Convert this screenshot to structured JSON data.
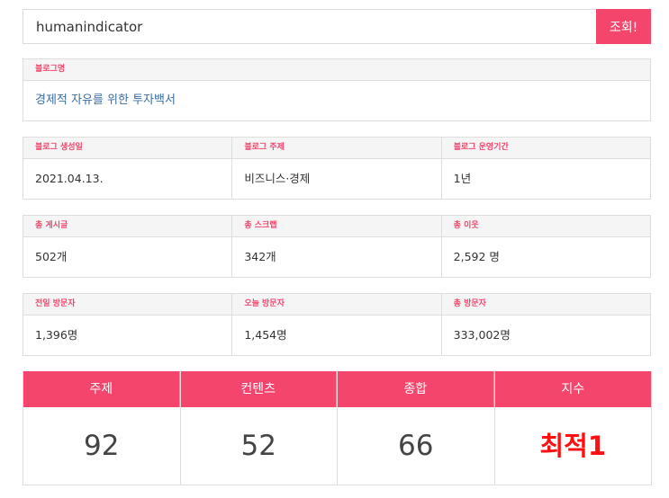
{
  "search": {
    "value": "humanindicator",
    "button_label": "조회!"
  },
  "blog": {
    "name_label": "블로그명",
    "name_value": "경제적 자유를 위한 투자백서"
  },
  "info": {
    "created_label": "블로그 생성일",
    "created_value": "2021.04.13.",
    "topic_label": "블로그 주제",
    "topic_value": "비즈니스·경제",
    "period_label": "블로그 운영기간",
    "period_value": "1년"
  },
  "stats": {
    "posts_label": "총 게시글",
    "posts_value": "502개",
    "scraps_label": "총 스크랩",
    "scraps_value": "342개",
    "neighbors_label": "총 이웃",
    "neighbors_value": "2,592 명"
  },
  "visitors": {
    "yesterday_label": "전일 방문자",
    "yesterday_value": "1,396명",
    "today_label": "오늘 방문자",
    "today_value": "1,454명",
    "total_label": "총 방문자",
    "total_value": "333,002명"
  },
  "scores": {
    "topic_label": "주제",
    "topic_value": "92",
    "content_label": "컨텐츠",
    "content_value": "52",
    "overall_label": "종합",
    "overall_value": "66",
    "index_label": "지수",
    "index_value": "최적1"
  },
  "colors": {
    "accent": "#f4456c",
    "highlight": "#ff1010",
    "link": "#3a6ea5"
  }
}
